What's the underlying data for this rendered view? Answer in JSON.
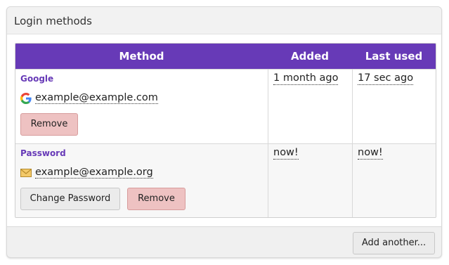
{
  "panel": {
    "title": "Login methods"
  },
  "table": {
    "headers": {
      "method": "Method",
      "added": "Added",
      "last_used": "Last used"
    },
    "header_color": "#673ab7",
    "rows": [
      {
        "method": "Google",
        "icon": "google-icon",
        "identity": "example@example.com",
        "buttons": [
          "Remove"
        ],
        "added": "1 month ago",
        "last_used": "17 sec ago"
      },
      {
        "method": "Password",
        "icon": "envelope-icon",
        "identity": "example@example.org",
        "buttons": [
          "Change Password",
          "Remove"
        ],
        "added": "now!",
        "last_used": "now!"
      }
    ]
  },
  "footer": {
    "add_button": "Add another..."
  }
}
